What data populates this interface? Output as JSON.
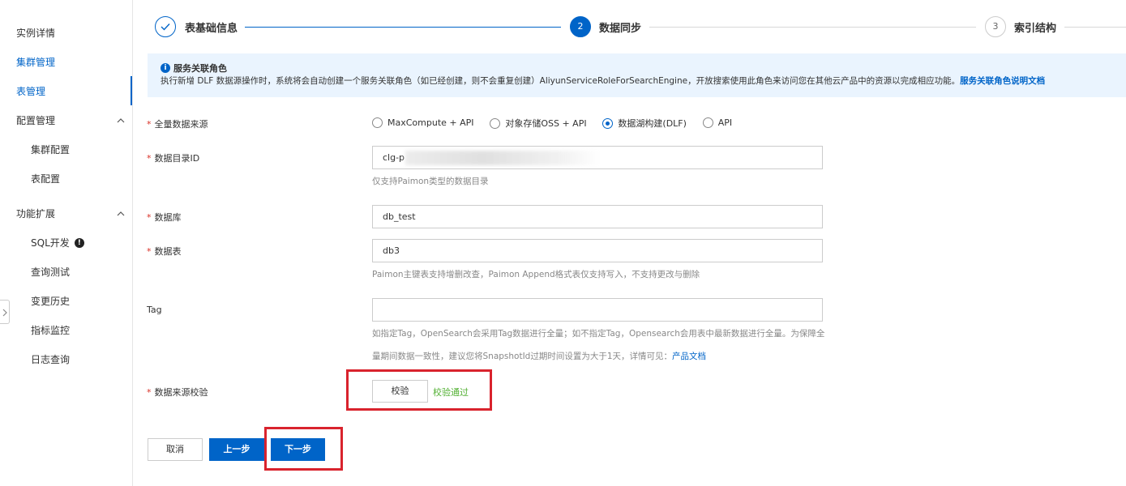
{
  "sidebar": {
    "items": [
      {
        "label": "实例详情"
      },
      {
        "label": "集群管理"
      },
      {
        "label": "表管理"
      }
    ],
    "config_group": {
      "label": "配置管理",
      "children": [
        {
          "label": "集群配置"
        },
        {
          "label": "表配置"
        }
      ]
    },
    "ext_group": {
      "label": "功能扩展",
      "children": [
        {
          "label": "SQL开发"
        },
        {
          "label": "查询测试"
        },
        {
          "label": "变更历史"
        },
        {
          "label": "指标监控"
        },
        {
          "label": "日志查询"
        }
      ]
    },
    "sql_badge": "!"
  },
  "steps": [
    {
      "number": "",
      "label": "表基础信息",
      "status": "done"
    },
    {
      "number": "2",
      "label": "数据同步",
      "status": "active"
    },
    {
      "number": "3",
      "label": "索引结构",
      "status": "wait"
    }
  ],
  "notice": {
    "icon": "i",
    "title": "服务关联角色",
    "body": "执行新增 DLF 数据源操作时，系统将会自动创建一个服务关联角色（如已经创建，则不会重复创建）AliyunServiceRoleForSearchEngine，开放搜索使用此角色来访问您在其他云产品中的资源以完成相应功能。",
    "link": "服务关联角色说明文档"
  },
  "form": {
    "source": {
      "label": "全量数据来源",
      "options": [
        {
          "label": "MaxCompute + API",
          "checked": false
        },
        {
          "label": "对象存储OSS + API",
          "checked": false
        },
        {
          "label": "数据湖构建(DLF)",
          "checked": true
        },
        {
          "label": "API",
          "checked": false
        }
      ]
    },
    "catalog": {
      "label": "数据目录ID",
      "value": "clg-p",
      "help": "仅支持Paimon类型的数据目录"
    },
    "database": {
      "label": "数据库",
      "value": "db_test"
    },
    "table": {
      "label": "数据表",
      "value": "db3",
      "help": "Paimon主键表支持增删改查，Paimon Append格式表仅支持写入，不支持更改与删除"
    },
    "tag": {
      "label": "Tag",
      "value": "",
      "help_line1": "如指定Tag，OpenSearch会采用Tag数据进行全量；如不指定Tag，Opensearch会用表中最新数据进行全量。为保障全",
      "help_line2": "量期间数据一致性，建议您将SnapshotId过期时间设置为大于1天，详情可见：",
      "help_link": "产品文档"
    },
    "verify": {
      "label": "数据来源校验",
      "button": "校验",
      "status": "校验通过"
    }
  },
  "footer": {
    "cancel": "取消",
    "prev": "上一步",
    "next": "下一步"
  },
  "colors": {
    "primary": "#0064c8",
    "success": "#52b033",
    "highlight": "#d9232d",
    "required": "#d93026"
  }
}
